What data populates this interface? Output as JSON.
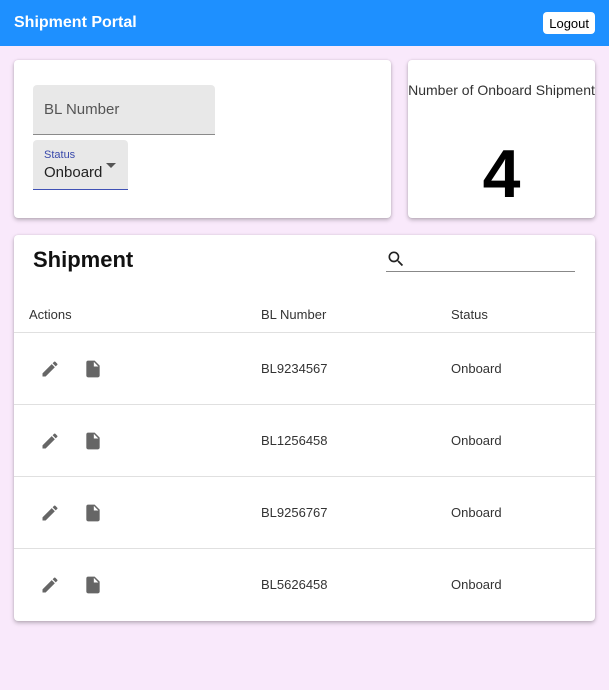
{
  "header": {
    "title": "Shipment Portal",
    "logout_label": "Logout"
  },
  "filters": {
    "bl_placeholder": "BL Number",
    "status_label": "Status",
    "status_value": "Onboard"
  },
  "summary": {
    "label": "Number of Onboard Shipment",
    "count": "4"
  },
  "table": {
    "title": "Shipment",
    "search_value": "",
    "columns": {
      "actions": "Actions",
      "bl": "BL Number",
      "status": "Status"
    },
    "rows": [
      {
        "bl": "BL9234567",
        "status": "Onboard"
      },
      {
        "bl": "BL1256458",
        "status": "Onboard"
      },
      {
        "bl": "BL9256767",
        "status": "Onboard"
      },
      {
        "bl": "BL5626458",
        "status": "Onboard"
      }
    ]
  },
  "colors": {
    "appbar": "#1e90ff",
    "background": "#f9e9fb",
    "icon": "#666666"
  },
  "icons": {
    "search": "search-icon",
    "edit": "pencil-icon",
    "document": "file-icon"
  }
}
